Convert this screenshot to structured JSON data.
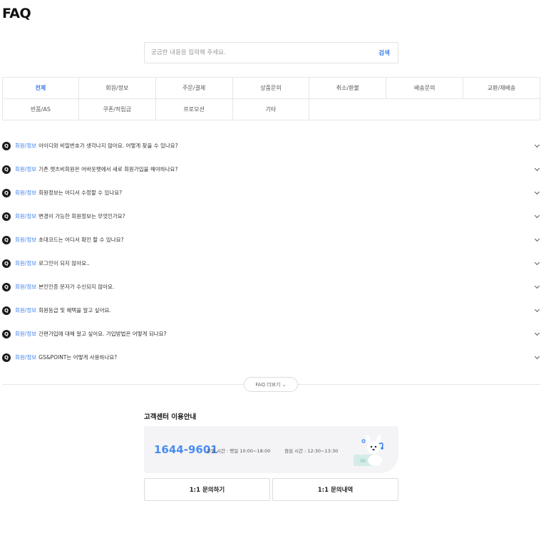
{
  "page": {
    "title": "FAQ"
  },
  "search": {
    "placeholder": "궁금한 내용을 입력해 주세요.",
    "button_label": "검색"
  },
  "categories": [
    {
      "label": "전체",
      "active": true
    },
    {
      "label": "회원/정보"
    },
    {
      "label": "주문/결제"
    },
    {
      "label": "상품문의"
    },
    {
      "label": "취소/환불"
    },
    {
      "label": "배송문의"
    },
    {
      "label": "교환/재배송"
    },
    {
      "label": "반품/AS"
    },
    {
      "label": "쿠폰/적립금"
    },
    {
      "label": "프로모션"
    },
    {
      "label": "기타"
    }
  ],
  "faq": {
    "q_badge": "Q",
    "items": [
      {
        "category": "회원/정보",
        "question": "아이디와 비밀번호가 생각나지 않아요. 어떻게 찾을 수 있나요?"
      },
      {
        "category": "회원/정보",
        "question": "기존 펫츠비회원은 어바웃펫에서 새로 회원가입을 해야하나요?"
      },
      {
        "category": "회원/정보",
        "question": "회원정보는 어디서 수정할 수 있나요?"
      },
      {
        "category": "회원/정보",
        "question": "변경이 가능한 회원정보는 무엇인가요?"
      },
      {
        "category": "회원/정보",
        "question": "초대코드는 어디서 확인 할 수 있나요?"
      },
      {
        "category": "회원/정보",
        "question": "로그인이 되지 않아요.."
      },
      {
        "category": "회원/정보",
        "question": "본인인증 문자가 수신되지 않아요."
      },
      {
        "category": "회원/정보",
        "question": "회원등급 및 혜택을 알고 싶어요."
      },
      {
        "category": "회원/정보",
        "question": "간편가입에 대해 알고 싶어요. 가입방법은 어떻게 되나요?"
      },
      {
        "category": "회원/정보",
        "question": "GS&POINT는 어떻게 사용하나요?"
      }
    ],
    "more_label": "FAQ 더보기 ⌄"
  },
  "customer_center": {
    "title": "고객센터 이용안내",
    "phone": "1644-9601",
    "hours": "운영 시간 : 평일 10:00~18:00",
    "break_time": "점심 시간 : 12:30~13:30",
    "inquiry_button": "1:1 문의하기",
    "history_button": "1:1 문의내역"
  },
  "colors": {
    "accent": "#3b7ff0",
    "phone": "#4a8cf0",
    "card_bg": "#f4f4f6"
  },
  "icons": {
    "faq_badge": "q-icon",
    "expand": "chevron-down-icon",
    "mascot": "mascot-illustration"
  }
}
